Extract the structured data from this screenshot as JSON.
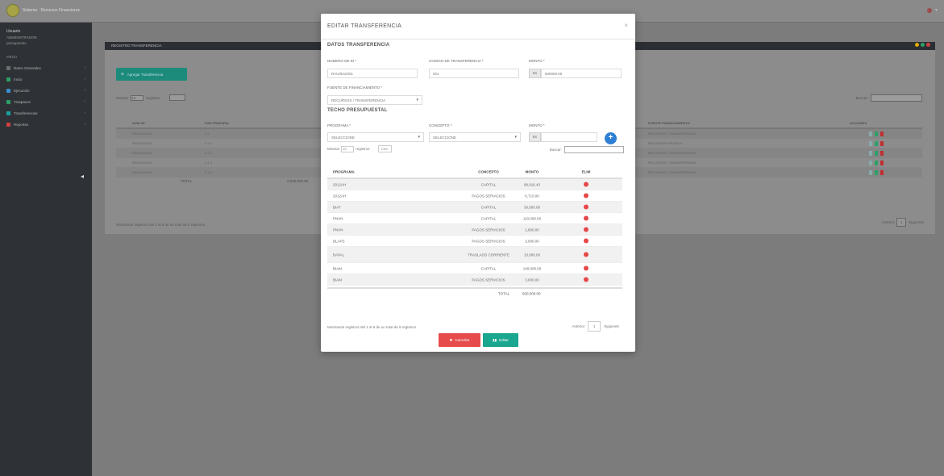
{
  "topbar": {
    "app_title": "Sistema · Recursos Financieros",
    "user_label": ""
  },
  "sidebar": {
    "user_name": "Usuario",
    "user_role": "ADMINISTRADOR",
    "user_sub": "presupuesto",
    "menu_header": "MENÚ",
    "items": [
      {
        "label": "Datos Generales",
        "color": "#6d6d6d"
      },
      {
        "label": "Inicio",
        "color": "#2ca067"
      },
      {
        "label": "Ejecución",
        "color": "#3b8fd0"
      },
      {
        "label": "Traspasos",
        "color": "#2ca067"
      },
      {
        "label": "Transferencias",
        "color": "#19a0a0"
      },
      {
        "label": "Reportes",
        "color": "#d04040"
      }
    ]
  },
  "panel": {
    "title": "REGISTRO TRANSFERENCIA",
    "add_label": "Agregar Transferencia",
    "show_label": "Mostrar",
    "show_value": "10",
    "show_suffix": "registros",
    "search_label": "Buscar:",
    "columns": [
      "NUM DE",
      "FUN PRINCIPAL",
      "FUENTE FINANCIAMIENTO",
      "ACCIONES"
    ],
    "rows": [
      {
        "c1": "RAU/001/001",
        "c2": "2.1",
        "c3": "RECURSOS / TRANSFERENCIA"
      },
      {
        "c1": "RAU/001/002",
        "c2": "2.1.1",
        "c3": "RECURSOS PROPIOS"
      },
      {
        "c1": "RAU/001/003",
        "c2": "2.1.2",
        "c3": "RECURSOS / TRANSFERENCIA"
      },
      {
        "c1": "RAU/001/004",
        "c2": "2.1.3",
        "c3": "RECURSOS / TRANSFERENCIA"
      },
      {
        "c1": "RAU/001/005",
        "c2": "2.1.4",
        "c3": "RECURSOS / TRANSFERENCIA"
      }
    ],
    "total_label": "TOTAL",
    "total_value": "2,000,000.00",
    "info": "Mostrando registros del 1 al 5 de un total de 5 registros",
    "prev": "Anterior",
    "page": "1",
    "next": "Siguiente"
  },
  "modal": {
    "title": "EDITAR TRANSFERENCIA",
    "close": "×",
    "section1": "DATOS TRANSFERENCIA",
    "field_num_label": "NUMERO DE ID *",
    "field_num_value": "RAU/001/001",
    "field_cod_label": "CODIGO DE TRANSFERENCIA *",
    "field_cod_value": "001",
    "field_monto_label": "MONTO *",
    "field_monto_addon": "Bs",
    "field_monto_value": "500000.00",
    "field_fuente_label": "FUENTE DE FINANCIAMIENTO *",
    "field_fuente_value": "RECURSOS / TRANSFERENCIA",
    "section2": "TECHO PRESUPUESTAL",
    "prog_label": "PROGRAMA *",
    "prog_value": "SELECCIONE",
    "conc_label": "CONCEPTO *",
    "conc_value": "SELECCIONE",
    "monto2_label": "MONTO *",
    "monto2_addon": "Bs",
    "add_button": "+",
    "show_label": "Mostrar",
    "show_value": "10",
    "show_suffix": "registros",
    "csv_label": "CSV",
    "search_label": "Buscar:",
    "columns": {
      "programa": "PROGRAMA",
      "concepto": "CONCEPTO",
      "monto": "MONTO",
      "eliminar": "ELIM"
    },
    "rows": [
      {
        "programa": "2012AH",
        "concepto": "CAPITAL",
        "monto": "98,916.43"
      },
      {
        "programa": "2012AH",
        "concepto": "PAGOS SERVICIOS",
        "monto": "6,710.00"
      },
      {
        "programa": "BIAT",
        "concepto": "CAPITAL",
        "monto": "30,000.00"
      },
      {
        "programa": "PNVN",
        "concepto": "CAPITAL",
        "monto": "110,000.00"
      },
      {
        "programa": "PNVN",
        "concepto": "PAGOS SERVICIOS",
        "monto": "1,800.00"
      },
      {
        "programa": "BLAPS",
        "concepto": "PAGOS SERVICIOS",
        "monto": "3,000.00"
      },
      {
        "programa": "BAPAL",
        "concepto": "TRASLADO CORRIENTE",
        "monto": "10,000.00"
      },
      {
        "programa": "BIAM",
        "concepto": "CAPITAL",
        "monto": "140,000.00"
      },
      {
        "programa": "BIAM",
        "concepto": "PAGOS SERVICIOS",
        "monto": "3,000.00"
      }
    ],
    "total_label": "TOTAL",
    "total_value": "500,000.00",
    "info": "Mostrando registros del 1 al 9 de un total de 9 registros",
    "prev": "Anterior",
    "page": "1",
    "next": "Siguiente",
    "cancel": "Cancelar",
    "save": "Editar"
  }
}
